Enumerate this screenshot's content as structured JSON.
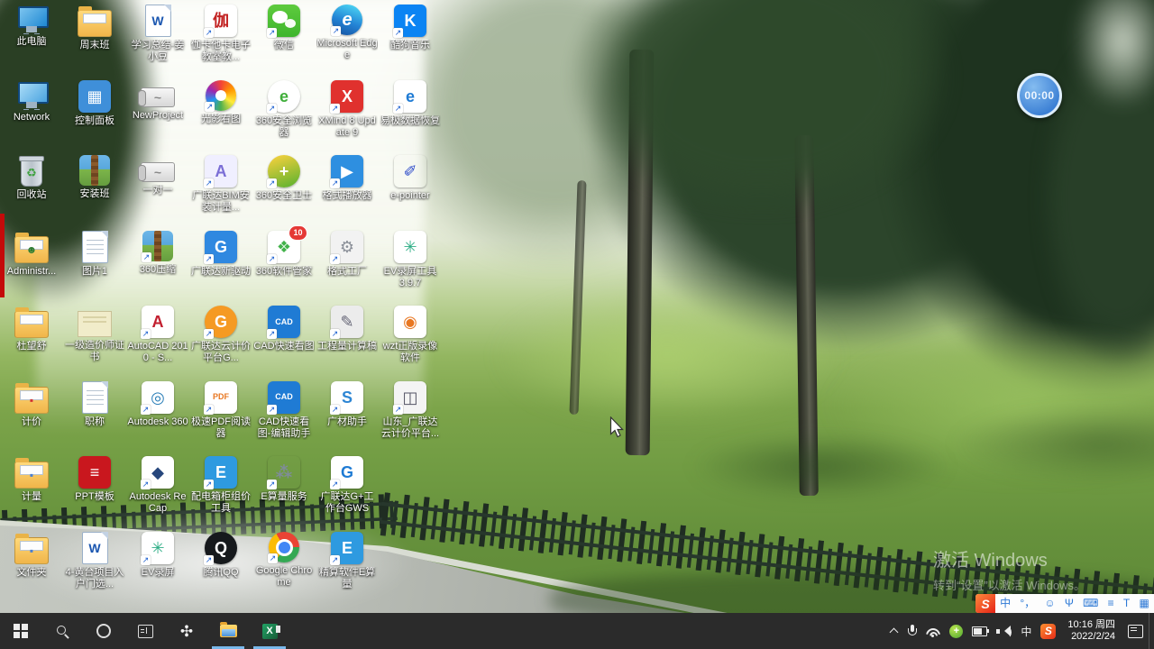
{
  "desktop": {
    "icons": [
      {
        "label": "此电脑",
        "col": 0,
        "row": 0,
        "kind": "pc",
        "sc": false
      },
      {
        "label": "Network",
        "col": 0,
        "row": 1,
        "kind": "network",
        "sc": false
      },
      {
        "label": "回收站",
        "col": 0,
        "row": 2,
        "kind": "bin",
        "glyph": "♻",
        "fg": "#3fa23f",
        "sc": false
      },
      {
        "label": "Administr...",
        "col": 0,
        "row": 3,
        "kind": "folder-user",
        "glyph": "☻",
        "fg": "#2e7d32",
        "sc": false
      },
      {
        "label": "杜望舒",
        "col": 0,
        "row": 4,
        "kind": "folder",
        "sc": false
      },
      {
        "label": "计价",
        "col": 0,
        "row": 5,
        "kind": "folder",
        "glyph": "▪",
        "fg": "#d33333",
        "sc": false
      },
      {
        "label": "计量",
        "col": 0,
        "row": 6,
        "kind": "folder",
        "glyph": "▪",
        "fg": "#4a7fd0",
        "sc": false
      },
      {
        "label": "文件夹",
        "col": 0,
        "row": 7,
        "kind": "folder",
        "glyph": "▪",
        "fg": "#4a7fd0",
        "sc": false
      },
      {
        "label": "周末班",
        "col": 1,
        "row": 0,
        "kind": "folder",
        "sc": false
      },
      {
        "label": "控制面板",
        "col": 1,
        "row": 1,
        "kind": "tile",
        "bg": "#3f8fd9",
        "glyph": "▦",
        "fg": "#ffffff",
        "sc": false
      },
      {
        "label": "安装班",
        "col": 1,
        "row": 2,
        "kind": "zip",
        "sc": false
      },
      {
        "label": "图片1",
        "col": 1,
        "row": 3,
        "kind": "page",
        "sc": false
      },
      {
        "label": "一级造价师证书",
        "col": 1,
        "row": 4,
        "kind": "cert",
        "sc": false
      },
      {
        "label": "职称",
        "col": 1,
        "row": 5,
        "kind": "page",
        "sc": false
      },
      {
        "label": "PPT模板",
        "col": 1,
        "row": 6,
        "kind": "tile",
        "bg": "#c9171e",
        "glyph": "≡",
        "fg": "#ffffff",
        "sc": false
      },
      {
        "label": "4-黄台项目入户门选...",
        "col": 1,
        "row": 7,
        "kind": "doc",
        "glyph": "W",
        "fg": "#1a56b0",
        "sc": false
      },
      {
        "label": "学习总结-姜小豆",
        "col": 2,
        "row": 0,
        "kind": "doc",
        "glyph": "W",
        "fg": "#1a56b0",
        "sc": false
      },
      {
        "label": "NewProject",
        "col": 2,
        "row": 1,
        "kind": "scroll",
        "glyph": "~",
        "fg": "#888888",
        "sc": false
      },
      {
        "label": "一对一",
        "col": 2,
        "row": 2,
        "kind": "scroll",
        "glyph": "~",
        "fg": "#888888",
        "sc": false
      },
      {
        "label": "360压缩",
        "col": 2,
        "row": 3,
        "kind": "zip",
        "sc": true
      },
      {
        "label": "AutoCAD 2010 - S...",
        "col": 2,
        "row": 4,
        "kind": "tile",
        "bg": "#ffffff",
        "glyph": "A",
        "fg": "#c21f2f",
        "sc": true
      },
      {
        "label": "Autodesk 360",
        "col": 2,
        "row": 5,
        "kind": "tile",
        "bg": "#ffffff",
        "glyph": "◎",
        "fg": "#2c7fb8",
        "sc": true
      },
      {
        "label": "Autodesk ReCap",
        "col": 2,
        "row": 6,
        "kind": "tile",
        "bg": "#ffffff",
        "glyph": "◆",
        "fg": "#27477d",
        "sc": true
      },
      {
        "label": "EV录屏",
        "col": 2,
        "row": 7,
        "kind": "tile",
        "bg": "#ffffff",
        "glyph": "✳",
        "fg": "#2fae86",
        "sc": true
      },
      {
        "label": "伽卡他卡电子教室教...",
        "col": 3,
        "row": 0,
        "kind": "tile",
        "bg": "#ffffff",
        "glyph": "伽",
        "fg": "#c22222",
        "sc": true
      },
      {
        "label": "光影看图",
        "col": 3,
        "row": 1,
        "kind": "rainbow",
        "sc": true
      },
      {
        "label": "广联达BIM安装计量...",
        "col": 3,
        "row": 2,
        "kind": "tile",
        "bg": "#f0efff",
        "glyph": "A",
        "fg": "#7b6ed6",
        "sc": true
      },
      {
        "label": "广联达新驱动",
        "col": 3,
        "row": 3,
        "kind": "tile",
        "bg": "#2f88e0",
        "glyph": "G",
        "fg": "#ffffff",
        "sc": true
      },
      {
        "label": "广联达云计价平台G...",
        "col": 3,
        "row": 4,
        "kind": "circle",
        "bg": "#f59a23",
        "glyph": "G",
        "fg": "#ffffff",
        "sc": true
      },
      {
        "label": "极速PDF阅读器",
        "col": 3,
        "row": 5,
        "kind": "tile",
        "bg": "#ffffff",
        "glyph": "PDF",
        "fg": "#e87722",
        "sc": true
      },
      {
        "label": "配电箱柜组价工具",
        "col": 3,
        "row": 6,
        "kind": "tile",
        "bg": "#2e9ae0",
        "glyph": "E",
        "fg": "#ffffff",
        "sc": true
      },
      {
        "label": "腾讯QQ",
        "col": 3,
        "row": 7,
        "kind": "circle",
        "bg": "#16191c",
        "glyph": "Q",
        "fg": "#ffffff",
        "sc": true
      },
      {
        "label": "微信",
        "col": 4,
        "row": 0,
        "kind": "wechat",
        "sc": true
      },
      {
        "label": "360安全浏览器",
        "col": 4,
        "row": 1,
        "kind": "circle",
        "bg": "#ffffff",
        "glyph": "e",
        "fg": "#3fae3a",
        "sc": true
      },
      {
        "label": "360安全卫士",
        "col": 4,
        "row": 2,
        "kind": "circle",
        "bg": "linear-gradient(160deg,#ffd23e,#56b12e)",
        "glyph": "+",
        "fg": "#ffffff",
        "sc": true
      },
      {
        "label": "360软件管家",
        "col": 4,
        "row": 3,
        "kind": "tile",
        "bg": "#ffffff",
        "glyph": "❖",
        "fg": "#42b24a",
        "badge": "10",
        "sc": true
      },
      {
        "label": "CAD快速看图",
        "col": 4,
        "row": 4,
        "kind": "tile",
        "bg": "#1f7bd4",
        "glyph": "CAD",
        "fg": "#ffffff",
        "sc": true
      },
      {
        "label": "CAD快速看图-编辑助手",
        "col": 4,
        "row": 5,
        "kind": "tile",
        "bg": "#1f7bd4",
        "glyph": "CAD",
        "fg": "#ffffff",
        "sc": true
      },
      {
        "label": "E算量服务",
        "col": 4,
        "row": 6,
        "kind": "tile",
        "bg": "transparent",
        "glyph": "⁂",
        "fg": "#7f8c99",
        "sc": true
      },
      {
        "label": "Google Chrome",
        "col": 4,
        "row": 7,
        "kind": "chrome",
        "sc": true
      },
      {
        "label": "Microsoft Edge",
        "col": 5,
        "row": 0,
        "kind": "edge",
        "glyph": "e",
        "sc": true
      },
      {
        "label": "XMind 8 Update 9",
        "col": 5,
        "row": 1,
        "kind": "tile",
        "bg": "#e0312e",
        "glyph": "X",
        "fg": "#ffffff",
        "sc": true
      },
      {
        "label": "格式播放器",
        "col": 5,
        "row": 2,
        "kind": "tile",
        "bg": "#2e8fe0",
        "glyph": "▶",
        "fg": "#ffffff",
        "sc": true
      },
      {
        "label": "格式工厂",
        "col": 5,
        "row": 3,
        "kind": "tile",
        "bg": "#f2f2f2",
        "glyph": "⚙",
        "fg": "#8a8f98",
        "sc": true
      },
      {
        "label": "工程量计算稿",
        "col": 5,
        "row": 4,
        "kind": "tile",
        "bg": "#ececec",
        "glyph": "✎",
        "fg": "#666677",
        "sc": true
      },
      {
        "label": "广材助手",
        "col": 5,
        "row": 5,
        "kind": "tile",
        "bg": "#ffffff",
        "glyph": "S",
        "fg": "#2e86d4",
        "sc": true
      },
      {
        "label": "广联达G+工作台GWS",
        "col": 5,
        "row": 6,
        "kind": "tile",
        "bg": "#ffffff",
        "glyph": "G",
        "fg": "#1f7bd4",
        "sc": true
      },
      {
        "label": "精算软件E算量",
        "col": 5,
        "row": 7,
        "kind": "tile",
        "bg": "#2e9ae0",
        "glyph": "E",
        "fg": "#ffffff",
        "sc": true
      },
      {
        "label": "酷狗音乐",
        "col": 6,
        "row": 0,
        "kind": "tile",
        "bg": "#0b84f3",
        "glyph": "K",
        "fg": "#ffffff",
        "sc": true
      },
      {
        "label": "易极数据恢复",
        "col": 6,
        "row": 1,
        "kind": "tile",
        "bg": "#ffffff",
        "glyph": "e",
        "fg": "#1f7bd4",
        "sc": true
      },
      {
        "label": "e-pointer",
        "col": 6,
        "row": 2,
        "kind": "tile",
        "bg": "transparent",
        "glyph": "✐",
        "fg": "#2b49c9",
        "sc": false
      },
      {
        "label": "EV录屏工具 3.9.7",
        "col": 6,
        "row": 3,
        "kind": "tile",
        "bg": "#ffffff",
        "glyph": "✳",
        "fg": "#2fae86",
        "sc": false
      },
      {
        "label": "wzt正版录像软件",
        "col": 6,
        "row": 4,
        "kind": "tile",
        "bg": "#ffffff",
        "glyph": "◉",
        "fg": "#e87722",
        "sc": false
      },
      {
        "label": "山东_广联达云计价平台...",
        "col": 6,
        "row": 5,
        "kind": "tile",
        "bg": "#f4f4f4",
        "glyph": "◫",
        "fg": "#555566",
        "sc": true
      }
    ]
  },
  "timer": {
    "value": "00:00"
  },
  "watermark": {
    "line1": "激活 Windows",
    "line2": "转到“设置”以激活 Windows。"
  },
  "taskbar": {
    "left": [
      {
        "name": "start-button",
        "icon": "start"
      },
      {
        "name": "search-button",
        "icon": "search"
      },
      {
        "name": "cortana-button",
        "icon": "cortana"
      },
      {
        "name": "task-view-button",
        "icon": "taskview"
      },
      {
        "name": "360-browser-taskbar-icon",
        "icon": "pinwheel",
        "g": "✣"
      },
      {
        "name": "file-explorer-taskbar-icon",
        "icon": "explorer",
        "running": true
      },
      {
        "name": "excel-taskbar-icon",
        "icon": "excel",
        "g": "X",
        "running": true
      }
    ],
    "tray": [
      {
        "name": "tray-expand-chevron-icon",
        "kind": "chevron"
      },
      {
        "name": "microphone-tray-icon",
        "kind": "mic"
      },
      {
        "name": "wifi-tray-icon",
        "kind": "wifi"
      },
      {
        "name": "360-shield-tray-icon",
        "kind": "shield"
      },
      {
        "name": "battery-tray-icon",
        "kind": "battery"
      },
      {
        "name": "volume-tray-icon",
        "kind": "speaker"
      },
      {
        "name": "ime-indicator",
        "kind": "ime",
        "g": "中"
      },
      {
        "name": "sogou-tray-icon",
        "kind": "sogou",
        "g": "S"
      }
    ],
    "clock": {
      "time": "10:16 周四",
      "date": "2022/2/24"
    }
  },
  "sogou_toolbar": {
    "logo": "S",
    "items": [
      {
        "name": "sogou-ime-cn",
        "g": "中"
      },
      {
        "name": "sogou-punctuation",
        "g": "°，"
      },
      {
        "name": "sogou-emoji",
        "g": "☺"
      },
      {
        "name": "sogou-voice",
        "g": "Ψ"
      },
      {
        "name": "sogou-keyboard",
        "g": "⌨"
      },
      {
        "name": "sogou-more",
        "g": "≡"
      },
      {
        "name": "sogou-skin",
        "g": "T"
      },
      {
        "name": "sogou-toolbox",
        "g": "▦"
      }
    ]
  },
  "colors": {
    "taskbar_bg": "#2b2b2b",
    "running_indicator": "#79b8ea",
    "timer_blue": "#3b7fd4",
    "sogou_red": "#e52417",
    "desktop_label_text": "#ffffff"
  }
}
